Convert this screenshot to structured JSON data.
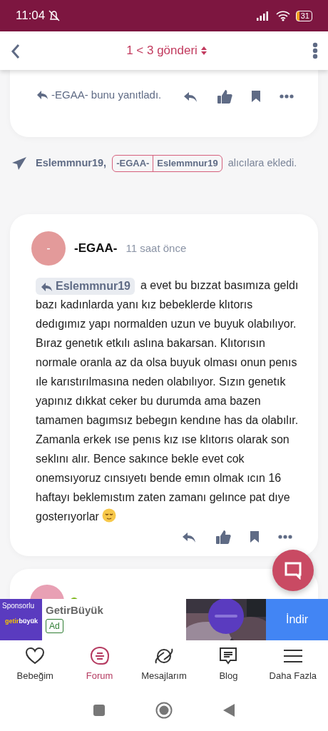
{
  "status_bar": {
    "time": "11:04",
    "battery": "31"
  },
  "header": {
    "title": "1 < 3 gönderi"
  },
  "previous_post": {
    "reply_note": "-EGAA- bunu yanıtladı."
  },
  "recipients_notice": {
    "actor": "Eslemmnur19,",
    "recipients": [
      "-EGAA-",
      "Eslemmnur19"
    ],
    "text": "alıcılara ekledi."
  },
  "post": {
    "avatar": "-",
    "author": "-EGAA-",
    "time": "11 saat önce",
    "reply_to": "Eslemmnur19",
    "body": "a evet bu bızzat basımıza geldı bazı kadınlarda yanı kız bebeklerde klıtorıs dedıgımız yapı normalden uzun ve buyuk olabılıyor. Bıraz genetık etkılı aslına bakarsan. Klıtorısın normale oranla az da olsa buyuk olması onun penıs ıle karıstırılmasına neden olabılıyor. Sızın genetık yapınız dıkkat ceker bu durumda ama bazen tamamen bagımsız bebegın kendıne has da olabılır. Zamanla erkek ıse penıs kız ıse klıtorıs olarak son seklını alır. Bence sakınce bekle evet cok onemsıyoruz cınsıyetı bende emın olmak ıcın 16 haftayı beklemıstım zaten zamanı gelınce pat dıye gosterıyorlar"
  },
  "ad": {
    "sponsor_label": "Sponsorlu",
    "logo_first": "getir",
    "logo_second": "büyük",
    "title": "GetirBüyük",
    "badge": "Ad",
    "button": "İndir"
  },
  "bottom_nav": [
    {
      "label": "Bebeğim",
      "kind": "heart",
      "selected": false
    },
    {
      "label": "Forum",
      "kind": "forum",
      "selected": true
    },
    {
      "label": "Mesajlarım",
      "kind": "planet",
      "selected": false
    },
    {
      "label": "Blog",
      "kind": "blog",
      "selected": false
    },
    {
      "label": "Daha Fazla",
      "kind": "menu",
      "selected": false
    }
  ]
}
